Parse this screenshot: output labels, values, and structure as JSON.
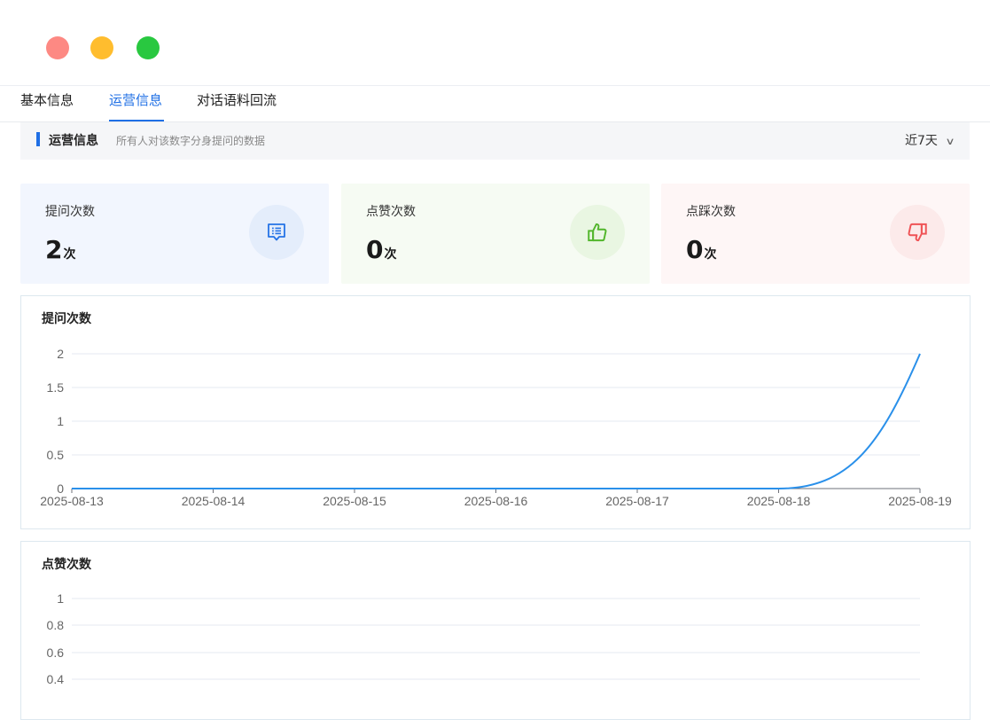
{
  "window": {
    "controls": [
      {
        "name": "close",
        "color": "#fd8983"
      },
      {
        "name": "minimize",
        "color": "#ffbd2e"
      },
      {
        "name": "maximize",
        "color": "#29c840"
      }
    ]
  },
  "tabs": [
    {
      "label": "基本信息",
      "active": false
    },
    {
      "label": "运营信息",
      "active": true
    },
    {
      "label": "对话语料回流",
      "active": false
    }
  ],
  "section": {
    "title": "运营信息",
    "subtitle": "所有人对该数字分身提问的数据",
    "range_label": "近7天",
    "range_icon": "chevron-down-icon"
  },
  "stats": [
    {
      "label": "提问次数",
      "value": "2",
      "unit": "次",
      "icon": "list-document-icon",
      "accent": "#2573e6",
      "bg": "#f2f6fe",
      "icon_bg": "#e4edfb"
    },
    {
      "label": "点赞次数",
      "value": "0",
      "unit": "次",
      "icon": "thumbs-up-icon",
      "accent": "#52b62c",
      "bg": "#f6fbf3",
      "icon_bg": "#e9f6e2"
    },
    {
      "label": "点踩次数",
      "value": "0",
      "unit": "次",
      "icon": "thumbs-down-icon",
      "accent": "#ef5356",
      "bg": "#fef6f6",
      "icon_bg": "#fceaea"
    }
  ],
  "chart_data": [
    {
      "type": "line",
      "title": "提问次数",
      "x": [
        "2025-08-13",
        "2025-08-14",
        "2025-08-15",
        "2025-08-16",
        "2025-08-17",
        "2025-08-18",
        "2025-08-19"
      ],
      "series": [
        {
          "values": [
            0,
            0,
            0,
            0,
            0,
            0,
            2
          ]
        }
      ],
      "yticks": [
        "0",
        "0.5",
        "1",
        "1.5",
        "2"
      ],
      "ylim": [
        0,
        2
      ],
      "smooth": true,
      "grid": true,
      "color": "#2a90ea"
    },
    {
      "type": "line",
      "title": "点赞次数",
      "yticks": [
        "0.4",
        "0.6",
        "0.8",
        "1"
      ],
      "ylim": [
        0,
        1
      ],
      "grid": true,
      "color": "#2a90ea"
    }
  ]
}
